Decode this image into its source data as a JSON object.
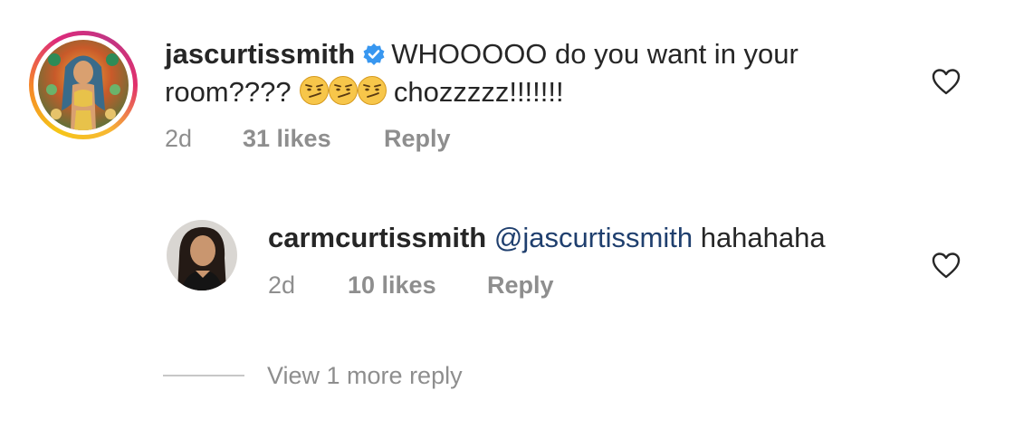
{
  "comment": {
    "username": "jascurtissmith",
    "text_line1": "WHOOOOO do you want in your",
    "text_line2_prefix": "room????",
    "text_line2_suffix": "chozzzzz!!!!!!!",
    "emoji_name": "smirking-emoji",
    "time": "2d",
    "likes": "31 likes",
    "reply_label": "Reply",
    "colors": {
      "text": "#262626",
      "meta": "#8e8e8e",
      "verified": "#3897f0"
    }
  },
  "reply": {
    "username": "carmcurtissmith",
    "mention": "@jascurtissmith",
    "text": "hahahaha",
    "time": "2d",
    "likes": "10 likes",
    "reply_label": "Reply",
    "colors": {
      "mention": "#1f3f6e"
    }
  },
  "view_more": {
    "label": "View 1 more reply"
  },
  "icons": {
    "like": "heart-outline-icon",
    "verified": "verified-badge-icon"
  }
}
